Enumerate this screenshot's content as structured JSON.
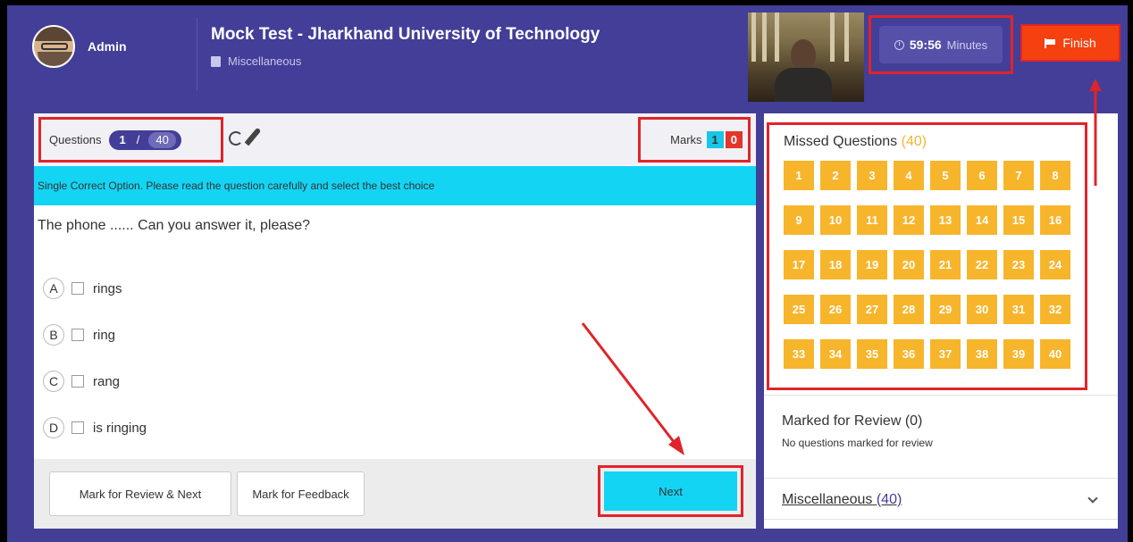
{
  "header": {
    "user_name": "Admin",
    "title": "Mock Test - Jharkhand University of Technology",
    "subtitle": "Miscellaneous",
    "timer_value": "59:56",
    "timer_unit": "Minutes",
    "finish_label": "Finish"
  },
  "question_bar": {
    "label": "Questions",
    "current": "1",
    "separator": "/",
    "total": "40",
    "marks_label": "Marks",
    "marks_positive": "1",
    "marks_negative": "0"
  },
  "instruction": "Single Correct Option. Please read the question carefully and select the best choice",
  "question": {
    "text": "The phone ...... Can you answer it, please?",
    "options": [
      {
        "letter": "A",
        "text": "rings"
      },
      {
        "letter": "B",
        "text": "ring"
      },
      {
        "letter": "C",
        "text": "rang"
      },
      {
        "letter": "D",
        "text": "is ringing"
      }
    ]
  },
  "footer": {
    "review_next_label": "Mark for Review & Next",
    "feedback_label": "Mark for Feedback",
    "next_label": "Next"
  },
  "sidebar": {
    "missed_title": "Missed Questions",
    "missed_count": "(40)",
    "question_numbers": [
      "1",
      "2",
      "3",
      "4",
      "5",
      "6",
      "7",
      "8",
      "9",
      "10",
      "11",
      "12",
      "13",
      "14",
      "15",
      "16",
      "17",
      "18",
      "19",
      "20",
      "21",
      "22",
      "23",
      "24",
      "25",
      "26",
      "27",
      "28",
      "29",
      "30",
      "31",
      "32",
      "33",
      "34",
      "35",
      "36",
      "37",
      "38",
      "39",
      "40"
    ],
    "review_title": "Marked for Review (0)",
    "review_subtitle": "No questions marked for review",
    "section_name": "Miscellaneous",
    "section_count": "(40)"
  },
  "colors": {
    "header_bg": "#433e97",
    "accent_cyan": "#14d4f4",
    "missed_cell": "#f7b52c",
    "finish_bg": "#f4410f",
    "annotation_red": "#e0242a"
  }
}
